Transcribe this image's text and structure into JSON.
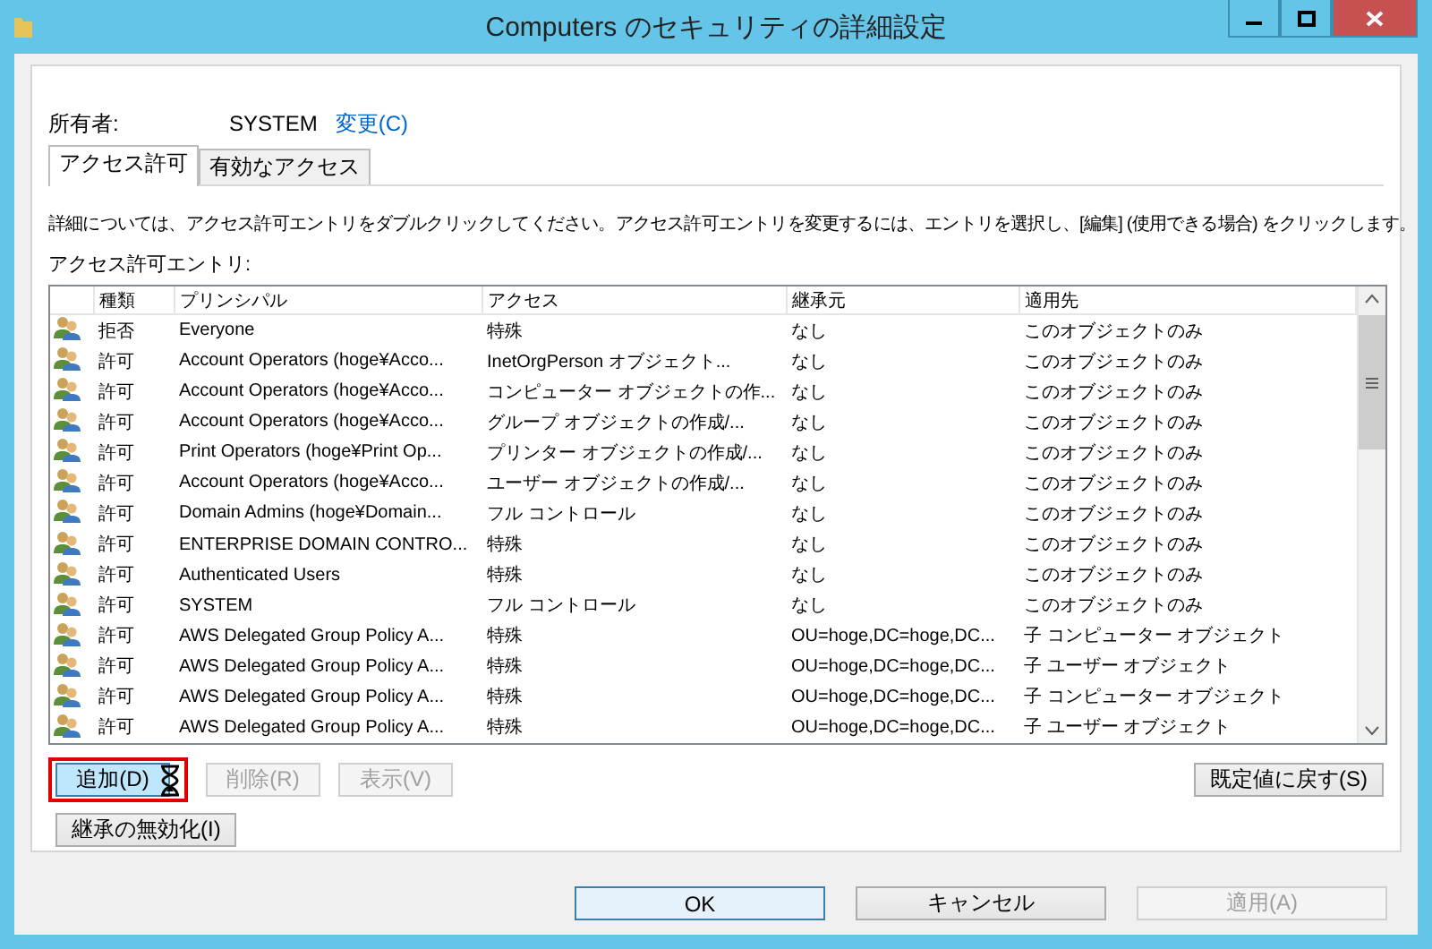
{
  "window": {
    "title": "Computers のセキュリティの詳細設定"
  },
  "owner": {
    "label": "所有者:",
    "value": "SYSTEM",
    "link": "変更(C)"
  },
  "tabs": [
    {
      "label": "アクセス許可",
      "selected": true
    },
    {
      "label": "有効なアクセス",
      "selected": false
    }
  ],
  "description": "詳細については、アクセス許可エントリをダブルクリックしてください。アクセス許可エントリを変更するには、エントリを選択し、[編集] (使用できる場合) をクリックします。",
  "entries_label": "アクセス許可エントリ:",
  "table": {
    "columns": [
      "種類",
      "プリンシパル",
      "アクセス",
      "継承元",
      "適用先"
    ],
    "rows": [
      {
        "type": "拒否",
        "principal": "Everyone",
        "access": "特殊",
        "inherited_from": "なし",
        "applies_to": "このオブジェクトのみ"
      },
      {
        "type": "許可",
        "principal": "Account Operators (hoge¥Acco...",
        "access": "InetOrgPerson オブジェクト...",
        "inherited_from": "なし",
        "applies_to": "このオブジェクトのみ"
      },
      {
        "type": "許可",
        "principal": "Account Operators (hoge¥Acco...",
        "access": "コンピューター オブジェクトの作...",
        "inherited_from": "なし",
        "applies_to": "このオブジェクトのみ"
      },
      {
        "type": "許可",
        "principal": "Account Operators (hoge¥Acco...",
        "access": "グループ オブジェクトの作成/...",
        "inherited_from": "なし",
        "applies_to": "このオブジェクトのみ"
      },
      {
        "type": "許可",
        "principal": "Print Operators (hoge¥Print Op...",
        "access": "プリンター オブジェクトの作成/...",
        "inherited_from": "なし",
        "applies_to": "このオブジェクトのみ"
      },
      {
        "type": "許可",
        "principal": "Account Operators (hoge¥Acco...",
        "access": "ユーザー オブジェクトの作成/...",
        "inherited_from": "なし",
        "applies_to": "このオブジェクトのみ"
      },
      {
        "type": "許可",
        "principal": "Domain Admins (hoge¥Domain...",
        "access": "フル コントロール",
        "inherited_from": "なし",
        "applies_to": "このオブジェクトのみ"
      },
      {
        "type": "許可",
        "principal": "ENTERPRISE DOMAIN CONTRO...",
        "access": "特殊",
        "inherited_from": "なし",
        "applies_to": "このオブジェクトのみ"
      },
      {
        "type": "許可",
        "principal": "Authenticated Users",
        "access": "特殊",
        "inherited_from": "なし",
        "applies_to": "このオブジェクトのみ"
      },
      {
        "type": "許可",
        "principal": "SYSTEM",
        "access": "フル コントロール",
        "inherited_from": "なし",
        "applies_to": "このオブジェクトのみ"
      },
      {
        "type": "許可",
        "principal": "AWS Delegated Group Policy A...",
        "access": "特殊",
        "inherited_from": "OU=hoge,DC=hoge,DC...",
        "applies_to": "子 コンピューター オブジェクト"
      },
      {
        "type": "許可",
        "principal": "AWS Delegated Group Policy A...",
        "access": "特殊",
        "inherited_from": "OU=hoge,DC=hoge,DC...",
        "applies_to": "子 ユーザー オブジェクト"
      },
      {
        "type": "許可",
        "principal": "AWS Delegated Group Policy A...",
        "access": "特殊",
        "inherited_from": "OU=hoge,DC=hoge,DC...",
        "applies_to": "子 コンピューター オブジェクト"
      },
      {
        "type": "許可",
        "principal": "AWS Delegated Group Policy A...",
        "access": "特殊",
        "inherited_from": "OU=hoge,DC=hoge,DC...",
        "applies_to": "子 ユーザー オブジェクト"
      }
    ]
  },
  "entry_buttons": [
    {
      "label": "追加(D)",
      "disabled": false,
      "highlighted": true
    },
    {
      "label": "削除(R)",
      "disabled": true,
      "highlighted": false
    },
    {
      "label": "表示(V)",
      "disabled": true,
      "highlighted": false
    }
  ],
  "restore_button": {
    "label": "既定値に戻す(S)",
    "disabled": false
  },
  "inheritance_button": {
    "label": "継承の無効化(I)",
    "disabled": false
  },
  "dialog_buttons": [
    {
      "label": "OK",
      "disabled": false,
      "default": true
    },
    {
      "label": "キャンセル",
      "disabled": false,
      "default": false
    },
    {
      "label": "適用(A)",
      "disabled": true,
      "default": false
    }
  ]
}
